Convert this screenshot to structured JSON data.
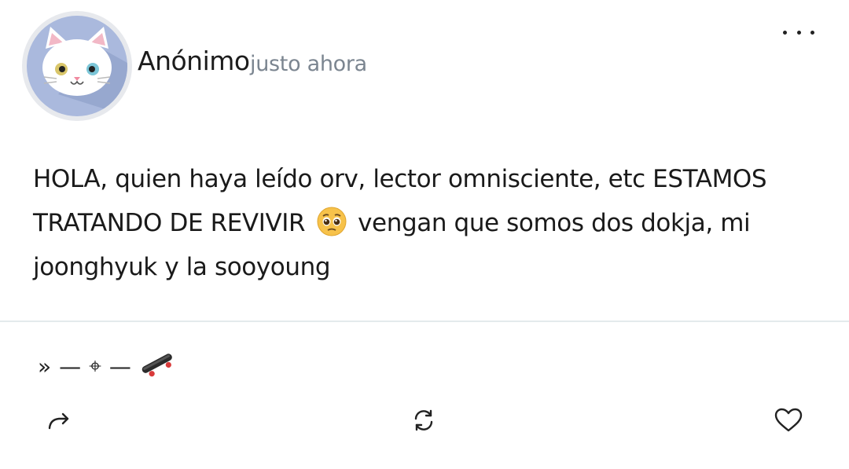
{
  "post": {
    "author": "Anónimo",
    "timestamp": "justo ahora",
    "text_before_emoji": "HOLA, quien haya leído orv, lector omnisciente, etc ESTAMOS TRATANDO DE REVIVIR",
    "emoji": "pleading-face-emoji",
    "text_after_emoji": "vengan que somos dos dokja, mi joonghyuk y la sooyoung"
  },
  "signature": {
    "chevrons": "»",
    "dash1": "—",
    "crosshair": "⌖",
    "dash2": "—",
    "skateboard_icon": "skateboard-icon"
  },
  "actions": {
    "share_icon": "share-arrow-icon",
    "repost_icon": "repost-icon",
    "like_icon": "heart-icon"
  },
  "colors": {
    "avatar_bg": "#aab9dd",
    "timestamp": "#7b8590",
    "divider": "#e4eaec"
  }
}
